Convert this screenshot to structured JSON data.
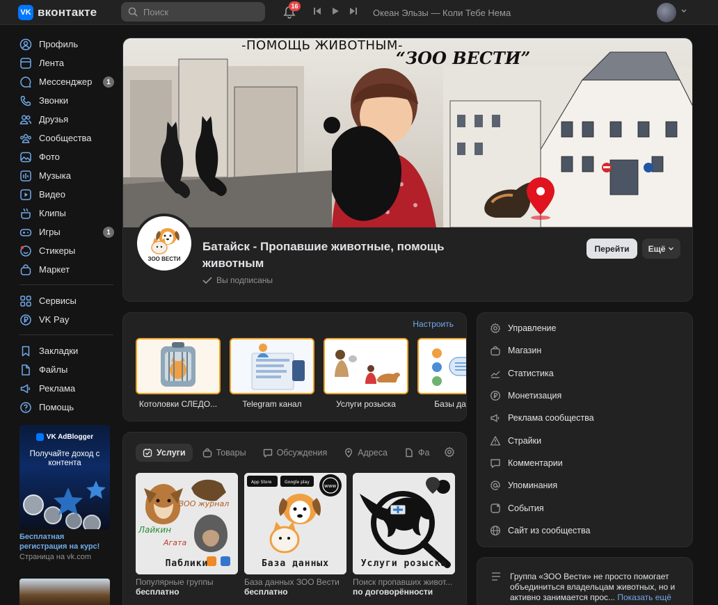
{
  "topbar": {
    "logo_text": "вконтакте",
    "logo_mark": "VK",
    "search_placeholder": "Поиск",
    "notifications_count": "16",
    "now_playing": "Океан Эльзы — Коли Тебе Нема"
  },
  "sidebar": {
    "items": [
      {
        "label": "Профиль",
        "icon": "profile-icon"
      },
      {
        "label": "Лента",
        "icon": "feed-icon"
      },
      {
        "label": "Мессенджер",
        "icon": "messenger-icon",
        "count": "1"
      },
      {
        "label": "Звонки",
        "icon": "phone-icon"
      },
      {
        "label": "Друзья",
        "icon": "friends-icon"
      },
      {
        "label": "Сообщества",
        "icon": "communities-icon"
      },
      {
        "label": "Фото",
        "icon": "photo-icon"
      },
      {
        "label": "Музыка",
        "icon": "music-icon"
      },
      {
        "label": "Видео",
        "icon": "video-icon"
      },
      {
        "label": "Клипы",
        "icon": "clips-icon"
      },
      {
        "label": "Игры",
        "icon": "games-icon",
        "count": "1"
      },
      {
        "label": "Стикеры",
        "icon": "stickers-icon"
      },
      {
        "label": "Маркет",
        "icon": "market-icon"
      }
    ],
    "items2": [
      {
        "label": "Сервисы",
        "icon": "services-icon"
      },
      {
        "label": "VK Pay",
        "icon": "vkpay-icon"
      }
    ],
    "items3": [
      {
        "label": "Закладки",
        "icon": "bookmark-icon"
      },
      {
        "label": "Файлы",
        "icon": "files-icon"
      },
      {
        "label": "Реклама",
        "icon": "ads-icon"
      },
      {
        "label": "Помощь",
        "icon": "help-icon"
      }
    ],
    "ad": {
      "brand": "VK AdBlogger",
      "headline": "Получайте доход с контента",
      "title": "Бесплатная регистрация на курс!",
      "subtitle": "Страница на vk.com"
    }
  },
  "cover": {
    "title": "-ПОМОЩЬ ЖИВОТНЫМ-",
    "brand": "“ЗОО ВЕСТИ”"
  },
  "group": {
    "avatar_text": "ЗОО ВЕСТИ",
    "name": "Батайск - Пропавшие животные, помощь животным",
    "subscribed": "Вы подписаны",
    "go_button": "Перейти",
    "more_button": "Ещё"
  },
  "links": {
    "configure": "Настроить",
    "items": [
      {
        "label": "Котоловки СЛЕДО..."
      },
      {
        "label": "Telegram канал"
      },
      {
        "label": "Услуги розыска"
      },
      {
        "label": "Базы данных"
      }
    ]
  },
  "tabs": {
    "items": [
      {
        "label": "Услуги",
        "icon": "services-tab-icon"
      },
      {
        "label": "Товары",
        "icon": "bag-icon"
      },
      {
        "label": "Обсуждения",
        "icon": "chat-icon"
      },
      {
        "label": "Адреса",
        "icon": "pin-icon"
      },
      {
        "label": "Фа",
        "icon": "file-icon"
      }
    ]
  },
  "services": [
    {
      "caption": "Паблики",
      "name": "Популярные группы",
      "price": "бесплатно",
      "img_text_1": "ЗОО журнал",
      "img_text_2": "Лайкин",
      "img_text_3": "Агата"
    },
    {
      "caption": "База данных",
      "name": "База данных ЗОО Вести",
      "price": "бесплатно",
      "img_text_1": "App Store",
      "img_text_2": "Google play",
      "img_text_3": "www"
    },
    {
      "caption": "Услуги розыска",
      "name": "Поиск пропавших живот...",
      "price": "по договорённости"
    }
  ],
  "manage": {
    "items": [
      {
        "label": "Управление",
        "icon": "gear-icon"
      },
      {
        "label": "Магазин",
        "icon": "shop-icon"
      },
      {
        "label": "Статистика",
        "icon": "stats-icon"
      },
      {
        "label": "Монетизация",
        "icon": "ruble-icon"
      },
      {
        "label": "Реклама сообщества",
        "icon": "megaphone-icon"
      },
      {
        "label": "Страйки",
        "icon": "warning-icon"
      },
      {
        "label": "Комментарии",
        "icon": "comment-icon"
      },
      {
        "label": "Упоминания",
        "icon": "at-icon"
      },
      {
        "label": "События",
        "icon": "events-icon"
      },
      {
        "label": "Сайт из сообщества",
        "icon": "globe-icon"
      }
    ]
  },
  "about": {
    "text": "Группа «ЗОО Вести» не просто помогает объединиться владельцам животных, но и активно занимается прос...",
    "show_more": "Показать ещё"
  },
  "colors": {
    "background": "#141414",
    "card": "#222222",
    "accent": "#71aaeb",
    "brand": "#0077ff",
    "badge": "#e64646"
  }
}
